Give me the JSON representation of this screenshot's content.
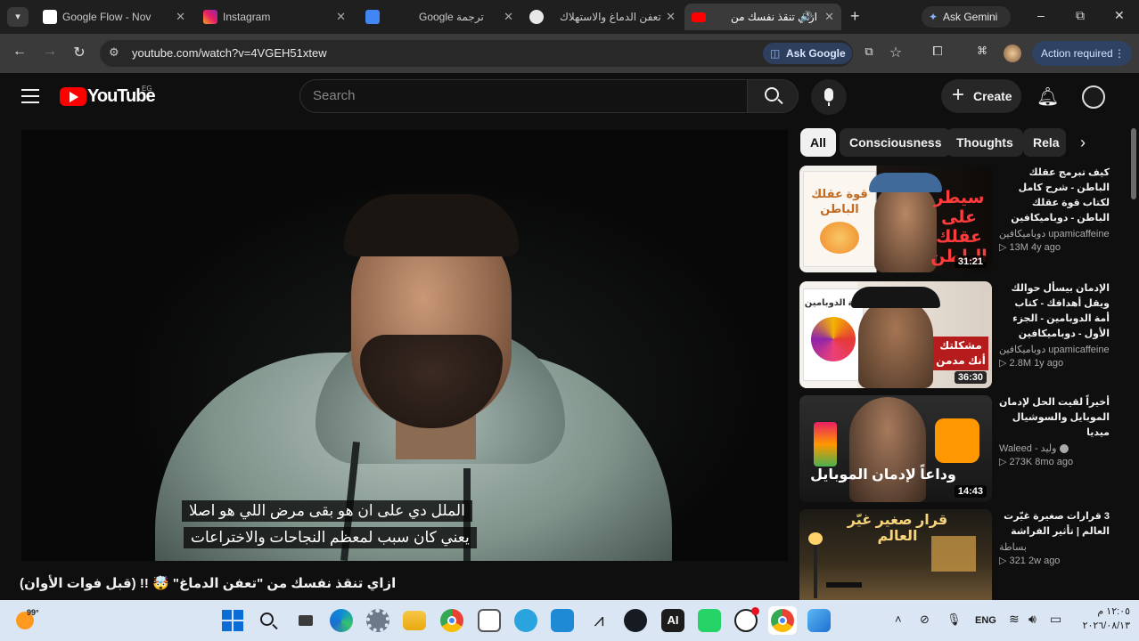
{
  "browser": {
    "tabs": [
      {
        "label": "Google Flow - Nov",
        "icon": "google-flow-icon",
        "active": false
      },
      {
        "label": "Instagram",
        "icon": "instagram-icon",
        "active": false
      },
      {
        "label": "Google ترجمة",
        "icon": "google-translate-icon",
        "active": false
      },
      {
        "label": "تعفن الدماغ والاستهلاك",
        "icon": "chatgpt-icon",
        "active": false
      },
      {
        "label": "ازاي تنقذ نفسك من",
        "icon": "youtube-icon",
        "active": true
      }
    ],
    "new_tab": "+",
    "ask_gemini": "Ask Gemini",
    "window_controls": {
      "minimize": "–",
      "maximize": "⧉",
      "close": "✕"
    },
    "url": "youtube.com/watch?v=4VGEH51xtew",
    "ask_google": "Ask Google",
    "action_required": "Action required"
  },
  "youtube": {
    "logo_text": "YouTube",
    "logo_region": "EG",
    "search_placeholder": "Search",
    "create_label": "Create"
  },
  "player": {
    "caption_line1": "الملل دي على ان هو بقى مرض اللي هو اصلا",
    "caption_line2": "يعني كان سبب لمعظم النجاحات والاختراعات"
  },
  "video": {
    "title": "ازاي تنقذ نفسك من \"تعفن الدماغ\" 🤯 !! (قبل فوات الأوان)"
  },
  "chips": [
    "All",
    "Consciousness",
    "Thoughts",
    "Rela"
  ],
  "recommendations": [
    {
      "title": "كيف تبرمج عقلك الباطن - شرح كامل لكتاب قوة عقلك الباطن - دوباميكافين",
      "channel": "دوباميكافين upamicaffeine",
      "views": "13M",
      "age": "4y ago",
      "duration": "31:21",
      "thumb_text": "سيطر على عقلك الباطن",
      "book_text": "قوة عقلك الباطن"
    },
    {
      "title": "الإدمان بيسأل حوالك ويقل أهدافك - كتاب أمة الدوبامين - الجزء الأول - دوباميكافين",
      "channel": "دوباميكافين upamicaffeine",
      "views": "2.8M",
      "age": "1y ago",
      "duration": "36:30",
      "thumb_text": "مشكلتك أنك مدمن",
      "book_text": "أمة الدوبامين"
    },
    {
      "title": "أخيراً لقيت الحل لإدمان الموبايل والسوشيال ميديا",
      "channel": "Waleed - وليد",
      "views": "273K",
      "age": "8mo ago",
      "duration": "14:43",
      "thumb_text": "وداعاً لإدمان الموبايل"
    },
    {
      "title": "3 قرارات صغيرة غيّرت العالم | تأثير الفراشة",
      "channel": "بساطة",
      "views": "321",
      "age": "2w ago",
      "duration": "",
      "thumb_text": "قرار صغير غيّر العالم"
    }
  ],
  "taskbar": {
    "weather": "99°",
    "language": "ENG",
    "time": "١٢:٠٥ م",
    "date": "٢٠٢٦/٠٨/١٣"
  },
  "colors": {
    "youtube_red": "#ff0000",
    "tab_bg": "#1f1f1f",
    "toolbar_bg": "#3a3a3a",
    "page_bg": "#0f0f0f",
    "taskbar_bg": "#dbe6f4",
    "ask_google_bg": "#2d3f5c",
    "action_required_bg": "#2e4363"
  }
}
